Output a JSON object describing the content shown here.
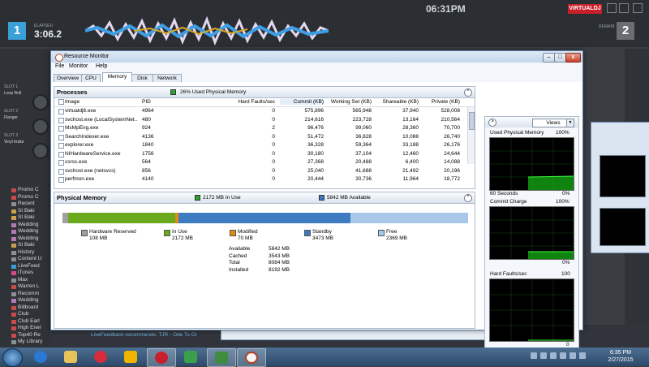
{
  "dj": {
    "elapsed_label": "ELAPSED",
    "elapsed": "3:06.2",
    "remain_label": "REMAIN",
    "deck1": "1",
    "deck2": "2",
    "clock": "06:31PM",
    "logo": "VIRTUALDJ",
    "slots": [
      "SLOT 1",
      "SLOT 2",
      "SLOT 3"
    ],
    "slot_names": [
      "Loop Roll",
      "Flanger",
      "Vinyl brake"
    ],
    "library": [
      "Promo C",
      "Promo C",
      "Recent",
      "St Baki",
      "St Baki",
      "Wedding",
      "Wedding",
      "Wedding",
      "St Baki",
      "History",
      "Content U",
      "LiveFeed",
      "iTunes",
      "Max",
      "Warren L",
      "Recomm",
      "Wedding",
      "Billboard",
      "Club",
      "Club Earl",
      "High Ener",
      "Top40 Re",
      "My Library"
    ],
    "recommend": "LiveFeedback recommends: TJR - Ode To Oi"
  },
  "rm": {
    "title": "Resource Monitor",
    "menu": [
      "File",
      "Monitor",
      "Help"
    ],
    "tabs": [
      "Overview",
      "CPU",
      "Memory",
      "Disk",
      "Network"
    ],
    "processes": {
      "title": "Processes",
      "summary": "26% Used Physical Memory",
      "columns": [
        "Image",
        "PID",
        "Hard Faults/sec",
        "Commit (KB)",
        "Working Set (KB)",
        "Shareable (KB)",
        "Private (KB)"
      ],
      "rows": [
        [
          "virtualdj8.exe",
          "4964",
          "0",
          "575,896",
          "565,948",
          "37,940",
          "528,008"
        ],
        [
          "svchost.exe (LocalSystemNet...",
          "480",
          "0",
          "214,616",
          "223,728",
          "13,164",
          "210,564"
        ],
        [
          "MsMpEng.exe",
          "924",
          "2",
          "96,476",
          "99,060",
          "28,360",
          "70,700"
        ],
        [
          "SearchIndexer.exe",
          "4136",
          "0",
          "51,472",
          "36,828",
          "10,088",
          "26,740"
        ],
        [
          "explorer.exe",
          "1840",
          "0",
          "36,328",
          "59,364",
          "33,188",
          "26,176"
        ],
        [
          "NIHardwareService.exe",
          "1756",
          "0",
          "30,180",
          "37,104",
          "12,460",
          "24,644"
        ],
        [
          "csrss.exe",
          "564",
          "0",
          "27,368",
          "20,488",
          "6,400",
          "14,088"
        ],
        [
          "svchost.exe (netsvcs)",
          "856",
          "0",
          "25,040",
          "41,688",
          "21,492",
          "20,196"
        ],
        [
          "perfmon.exe",
          "4140",
          "0",
          "20,444",
          "30,736",
          "11,964",
          "18,772"
        ]
      ]
    },
    "physical": {
      "title": "Physical Memory",
      "in_use_hdr": "2172 MB In Use",
      "available_hdr": "5842 MB Available",
      "legend": [
        {
          "label": "Hardware Reserved",
          "value": "108 MB",
          "color": "#a0a0a0"
        },
        {
          "label": "In Use",
          "value": "2172 MB",
          "color": "#6aa81e"
        },
        {
          "label": "Modified",
          "value": "70 MB",
          "color": "#e38b0d"
        },
        {
          "label": "Standby",
          "value": "3473 MB",
          "color": "#3e7cc2"
        },
        {
          "label": "Free",
          "value": "2369 MB",
          "color": "#a8c8ea"
        }
      ],
      "stats": [
        {
          "k": "Available",
          "v": "5842 MB"
        },
        {
          "k": "Cached",
          "v": "3543 MB"
        },
        {
          "k": "Total",
          "v": "8084 MB"
        },
        {
          "k": "Installed",
          "v": "8192 MB"
        }
      ]
    },
    "graphs": {
      "views": "Views",
      "g1_title": "Used Physical Memory",
      "g1_max": "100%",
      "g1_xl": "60 Seconds",
      "g1_xr": "0%",
      "g2_title": "Commit Charge",
      "g2_max": "100%",
      "g2_xr": "0%",
      "g3_title": "Hard Faults/sec",
      "g3_max": "100",
      "g3_xr": "0"
    }
  },
  "taskbar": {
    "time": "6:35 PM",
    "date": "2/27/2015"
  }
}
